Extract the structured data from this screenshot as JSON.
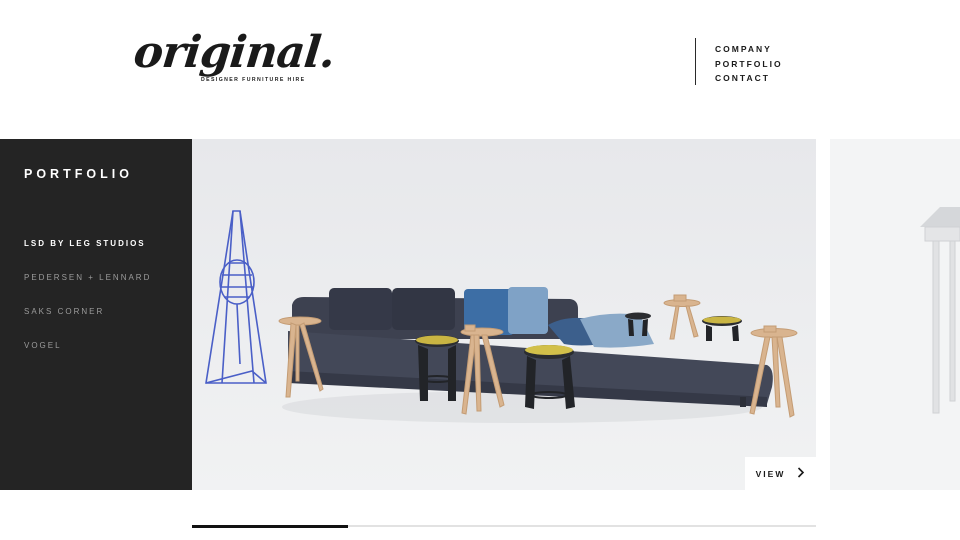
{
  "header": {
    "logo_text": "original.",
    "logo_tagline": "DESIGNER FURNITURE HIRE",
    "nav": [
      {
        "label": "COMPANY"
      },
      {
        "label": "PORTFOLIO"
      },
      {
        "label": "CONTACT"
      }
    ]
  },
  "sidebar": {
    "title": "PORTFOLIO",
    "items": [
      {
        "label": "LSD BY LEG STUDIOS",
        "active": true
      },
      {
        "label": "PEDERSEN + LENNARD",
        "active": false
      },
      {
        "label": "SAKS CORNER",
        "active": false
      },
      {
        "label": "VOGEL",
        "active": false
      }
    ]
  },
  "slider": {
    "view_label": "VIEW",
    "progress": 0.25
  },
  "colors": {
    "sidebar_bg": "#242424",
    "sofa": "#3b3f4b",
    "lamp": "#4a5fc7",
    "wood": "#d9b48f"
  }
}
